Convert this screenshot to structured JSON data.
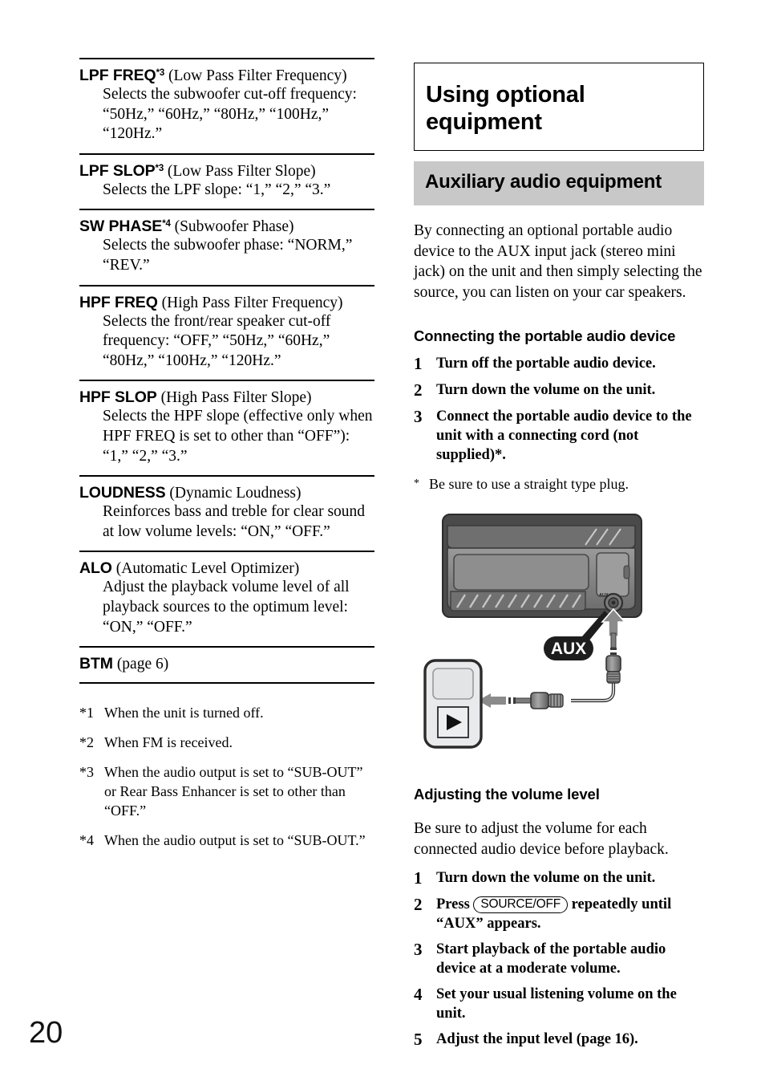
{
  "page_number": "20",
  "left_column": {
    "entries": [
      {
        "term": "LPF FREQ",
        "sup": "*3",
        "paren": " (Low Pass Filter Frequency)",
        "desc": "Selects the subwoofer cut-off frequency: “50Hz,” “60Hz,” “80Hz,” “100Hz,” “120Hz.”"
      },
      {
        "term": "LPF SLOP",
        "sup": "*3",
        "paren": " (Low Pass Filter Slope)",
        "desc": "Selects the LPF slope: “1,” “2,” “3.”"
      },
      {
        "term": "SW PHASE",
        "sup": "*4",
        "paren": " (Subwoofer Phase)",
        "desc": "Selects the subwoofer phase: “NORM,” “REV.”"
      },
      {
        "term": "HPF FREQ",
        "sup": "",
        "paren": " (High Pass Filter Frequency)",
        "desc": "Selects the front/rear speaker cut-off frequency: “OFF,” “50Hz,” “60Hz,” “80Hz,” “100Hz,” “120Hz.”"
      },
      {
        "term": "HPF SLOP",
        "sup": "",
        "paren": " (High Pass Filter Slope)",
        "desc": "Selects the HPF slope (effective only when HPF FREQ is set to other than “OFF”): “1,” “2,” “3.”"
      },
      {
        "term": "LOUDNESS",
        "sup": "",
        "paren": " (Dynamic Loudness)",
        "desc": "Reinforces bass and treble for clear sound at low volume levels: “ON,” “OFF.”"
      },
      {
        "term": "ALO",
        "sup": "",
        "paren": " (Automatic Level Optimizer)",
        "desc": "Adjust the playback volume level of all playback sources to the optimum level: “ON,” “OFF.”"
      },
      {
        "term": "BTM",
        "sup": "",
        "paren": " (page 6)",
        "desc": ""
      }
    ],
    "footnotes": [
      {
        "mark": "*1",
        "text": "When the unit is turned off."
      },
      {
        "mark": "*2",
        "text": "When FM is received."
      },
      {
        "mark": "*3",
        "text": "When the audio output is set to “SUB-OUT” or Rear Bass Enhancer is set to other than “OFF.”"
      },
      {
        "mark": "*4",
        "text": "When the audio output is set to “SUB-OUT.”"
      }
    ]
  },
  "right_column": {
    "chapter_title": "Using optional equipment",
    "section_title": "Auxiliary audio equipment",
    "intro_paragraph": "By connecting an optional portable audio device to the AUX input jack (stereo mini jack) on the unit and then simply selecting the source, you can listen on your car speakers.",
    "connecting": {
      "heading": "Connecting the portable audio device",
      "steps": [
        {
          "num": "1",
          "text": "Turn off the portable audio device."
        },
        {
          "num": "2",
          "text": "Turn down the volume on the unit."
        },
        {
          "num": "3",
          "text": "Connect the portable audio device to the unit with a connecting cord (not supplied)*."
        }
      ],
      "note_mark": "*",
      "note_text": "Be sure to use a straight type plug."
    },
    "illustration": {
      "aux_badge_label": "AUX",
      "jack_label": "AUX",
      "play_icon": "play-triangle"
    },
    "adjusting": {
      "heading": "Adjusting the volume level",
      "paragraph": "Be sure to adjust the volume for each connected audio device before playback.",
      "steps": [
        {
          "num": "1",
          "text": "Turn down the volume on the unit.",
          "key": null,
          "before": null,
          "after": null
        },
        {
          "num": "2",
          "text": null,
          "before": "Press ",
          "key": "SOURCE/OFF",
          "after": " repeatedly until “AUX” appears."
        },
        {
          "num": "3",
          "text": "Start playback of the portable audio device at a moderate volume.",
          "key": null,
          "before": null,
          "after": null
        },
        {
          "num": "4",
          "text": "Set your usual listening volume on the unit.",
          "key": null,
          "before": null,
          "after": null
        },
        {
          "num": "5",
          "text": "Adjust the input level (page 16).",
          "key": null,
          "before": null,
          "after": null
        }
      ]
    }
  },
  "colors": {
    "band_gray": "#c8c8c8",
    "unit_body": "#8a8a8a",
    "unit_dark": "#3b3b3b",
    "device_fill": "#e8eaec",
    "arrow_gray": "#8b8b8b"
  }
}
